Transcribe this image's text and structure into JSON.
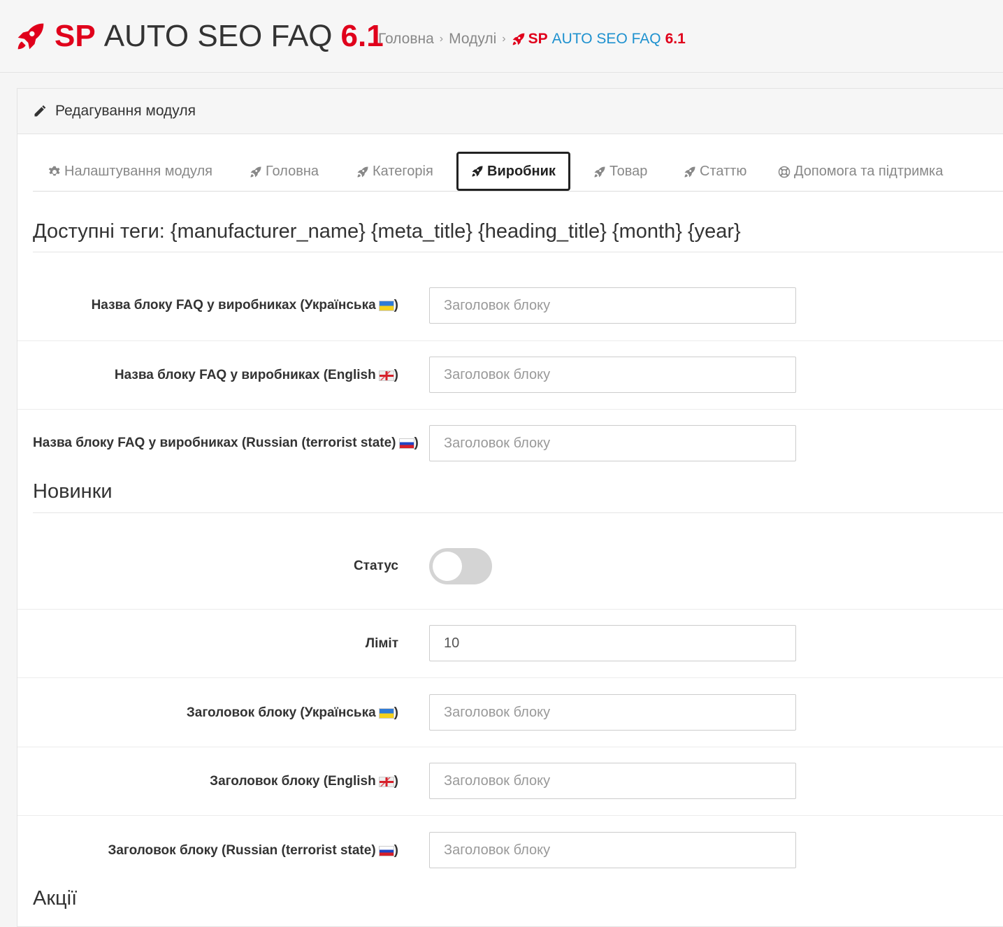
{
  "header": {
    "logo_sp": "SP",
    "logo_name": "AUTO SEO FAQ",
    "logo_version": "6.1",
    "breadcrumb": [
      "Головна",
      "Модулі"
    ],
    "breadcrumb_active": {
      "sp": "SP",
      "name": "AUTO SEO FAQ",
      "version": "6.1"
    }
  },
  "panel": {
    "title": "Редагування модуля"
  },
  "tabs": [
    {
      "label": "Налаштування модуля",
      "icon": "gear-icon"
    },
    {
      "label": "Головна",
      "icon": "rocket-icon"
    },
    {
      "label": "Категорія",
      "icon": "rocket-icon"
    },
    {
      "label": "Виробник",
      "icon": "rocket-icon",
      "active": true
    },
    {
      "label": "Товар",
      "icon": "rocket-icon"
    },
    {
      "label": "Статтю",
      "icon": "rocket-icon"
    },
    {
      "label": "Допомога та підтримка",
      "icon": "lifebuoy-icon"
    }
  ],
  "tags_heading": "Доступні теги: {manufacturer_name} {meta_title} {heading_title} {month} {year}",
  "faq_title": {
    "ua_label": "Назва блоку FAQ у виробниках (Українська",
    "en_label": "Назва блоку FAQ у виробниках (English",
    "ru_label": "Назва блоку FAQ у виробниках (Russian (terrorist state)",
    "placeholder": "Заголовок блоку"
  },
  "new_section": {
    "heading": "Новинки",
    "status_label": "Статус",
    "status_on": false,
    "limit_label": "Ліміт",
    "limit_value": "10",
    "title_ua_label": "Заголовок блоку (Українська",
    "title_en_label": "Заголовок блоку (English",
    "title_ru_label": "Заголовок блоку (Russian (terrorist state)",
    "placeholder": "Заголовок блоку"
  },
  "specials_heading": "Акції",
  "colors": {
    "brand_red": "#e0001b",
    "link_blue": "#1e91cf"
  }
}
